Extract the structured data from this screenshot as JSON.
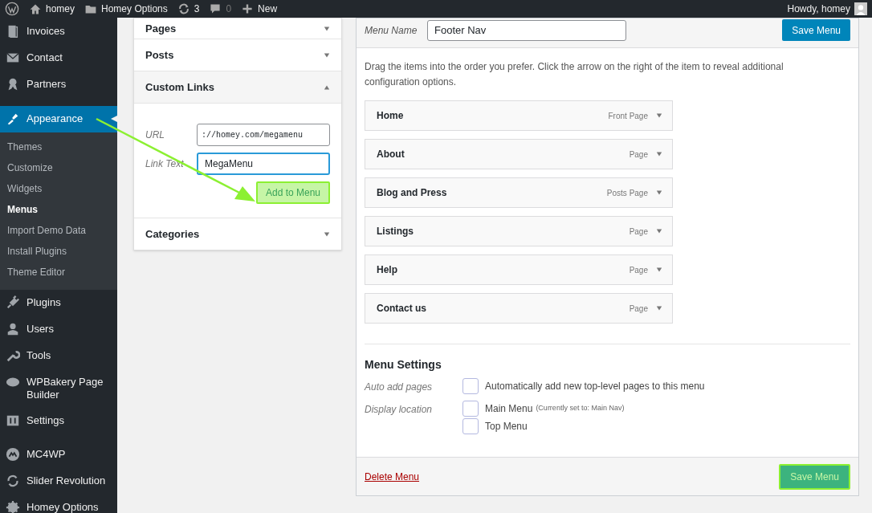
{
  "admin_bar": {
    "items": [
      {
        "label": "homey"
      },
      {
        "label": "Homey Options"
      },
      {
        "label": "3"
      },
      {
        "label": "0"
      },
      {
        "label": "New"
      }
    ],
    "greeting": "Howdy, homey"
  },
  "sidebar": {
    "items": [
      {
        "label": "Invoices",
        "selected": false
      },
      {
        "label": "Contact",
        "selected": false
      },
      {
        "label": "Partners",
        "selected": false
      },
      {
        "label": "Appearance",
        "selected": true,
        "children": [
          {
            "label": "Themes",
            "selected": false
          },
          {
            "label": "Customize",
            "selected": false
          },
          {
            "label": "Widgets",
            "selected": false
          },
          {
            "label": "Menus",
            "selected": true
          },
          {
            "label": "Import Demo Data",
            "selected": false
          },
          {
            "label": "Install Plugins",
            "selected": false
          },
          {
            "label": "Theme Editor",
            "selected": false
          }
        ]
      },
      {
        "label": "Plugins",
        "selected": false
      },
      {
        "label": "Users",
        "selected": false
      },
      {
        "label": "Tools",
        "selected": false
      },
      {
        "label": "WPBakery Page Builder",
        "selected": false
      },
      {
        "label": "Settings",
        "selected": false
      },
      {
        "label": "MC4WP",
        "selected": false
      },
      {
        "label": "Slider Revolution",
        "selected": false
      },
      {
        "label": "Homey Options",
        "selected": false
      }
    ]
  },
  "add_items": {
    "sections": [
      {
        "title": "Pages",
        "expanded": false
      },
      {
        "title": "Posts",
        "expanded": false
      },
      {
        "title": "Custom Links",
        "expanded": true,
        "fields": [
          {
            "label": "URL",
            "value": "://homey.com/megamenu",
            "focused": false
          },
          {
            "label": "Link Text",
            "value": "MegaMenu",
            "focused": true
          }
        ],
        "button": "Add to Menu"
      },
      {
        "title": "Categories",
        "expanded": false
      }
    ]
  },
  "menu": {
    "name_label": "Menu Name",
    "name_value": "Footer Nav",
    "save_top": "Save Menu",
    "instructions": "Drag the items into the order you prefer. Click the arrow on the right of the item to reveal additional configuration options.",
    "items": [
      {
        "title": "Home",
        "type": "Front Page"
      },
      {
        "title": "About",
        "type": "Page"
      },
      {
        "title": "Blog and Press",
        "type": "Posts Page"
      },
      {
        "title": "Listings",
        "type": "Page"
      },
      {
        "title": "Help",
        "type": "Page"
      },
      {
        "title": "Contact us",
        "type": "Page"
      }
    ],
    "settings": {
      "heading": "Menu Settings",
      "rows": [
        {
          "label": "Auto add pages",
          "options": [
            {
              "label": "Automatically add new top-level pages to this menu",
              "checked": false
            }
          ]
        },
        {
          "label": "Display location",
          "options": [
            {
              "label": "Main Menu",
              "note": "(Currently set to: Main Nav)",
              "checked": false
            },
            {
              "label": "Top Menu",
              "checked": false
            }
          ]
        }
      ]
    },
    "delete_link": "Delete Menu",
    "save_bottom": "Save Menu"
  }
}
